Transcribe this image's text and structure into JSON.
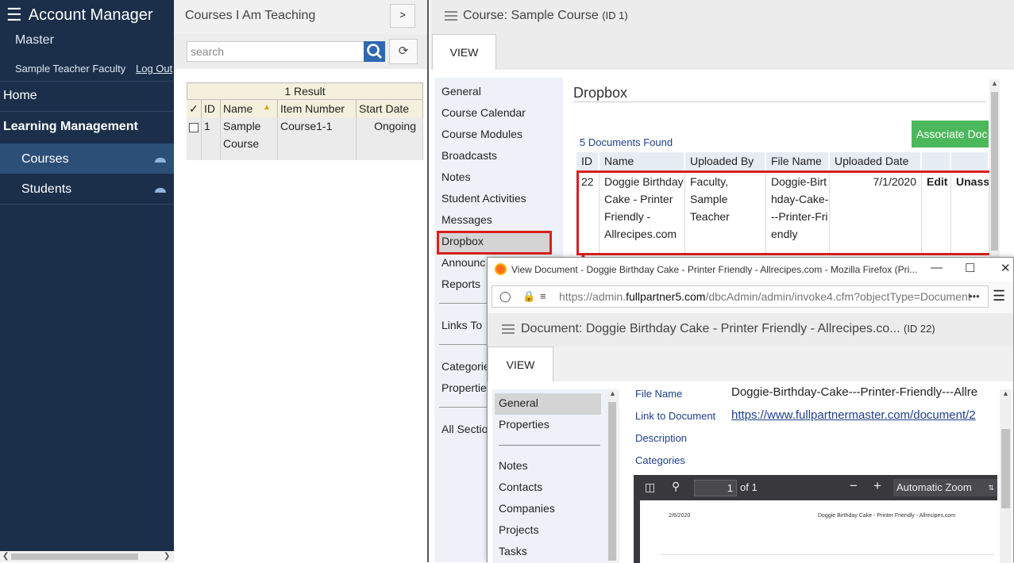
{
  "sidebar": {
    "app_title": "Account Manager",
    "org": "Master",
    "user": "Sample Teacher Faculty",
    "logout": "Log Out",
    "home": "Home",
    "section": "Learning Management",
    "items": [
      {
        "label": "Courses"
      },
      {
        "label": "Students"
      }
    ]
  },
  "course_list": {
    "title": "Courses I Am Teaching",
    "expand_label": ">",
    "search_placeholder": "search",
    "result_count": "1 Result",
    "columns": [
      "✓",
      "ID",
      "Name",
      "Item Number",
      "Start Date"
    ],
    "rows": [
      {
        "id": "1",
        "name": "Sample Course",
        "item_number": "Course1-1",
        "start_date": "Ongoing"
      }
    ]
  },
  "course": {
    "title": "Course: Sample Course",
    "id_label": "(ID 1)",
    "tab": "VIEW",
    "nav": [
      "General",
      "Course Calendar",
      "Course Modules",
      "Broadcasts",
      "Notes",
      "Student Activities",
      "Messages",
      "Dropbox",
      "Announc",
      "Reports",
      "Links To",
      "Categorie",
      "Propertie",
      "All Sectio"
    ],
    "dropbox": {
      "title": "Dropbox",
      "button": "Associate Doc",
      "found": "5 Documents Found",
      "columns": [
        "ID",
        "Name",
        "Uploaded By",
        "File Name",
        "Uploaded Date"
      ],
      "row": {
        "id": "22",
        "name": "Doggie Birthday Cake - Printer Friendly - Allrecipes.com",
        "uploaded_by": "Faculty, Sample Teacher",
        "file_name": "Doggie-Birthday-Cake---Printer-Friendly",
        "uploaded_date": "7/1/2020",
        "edit": "Edit",
        "unassign": "Unass"
      }
    }
  },
  "popup": {
    "window_title": "View Document - Doggie Birthday Cake - Printer Friendly - Allrecipes.com - Mozilla Firefox (Pri...",
    "url_prefix": "https://",
    "url_host_pre": "admin.",
    "url_host": "fullpartner5.com",
    "url_path": "/dbcAdmin/admin/invoke4.cfm?objectType=Document",
    "doc_title": "Document: Doggie Birthday Cake - Printer Friendly - Allrecipes.co...",
    "doc_id": "(ID 22)",
    "tab": "VIEW",
    "nav": [
      "General",
      "Properties",
      "Notes",
      "Contacts",
      "Companies",
      "Projects",
      "Tasks"
    ],
    "fields": [
      {
        "label": "File Name",
        "value": "Doggie-Birthday-Cake---Printer-Friendly---Allre"
      },
      {
        "label": "Link to Document",
        "value": "https://www.fullpartnermaster.com/document/2"
      },
      {
        "label": "Description",
        "value": ""
      },
      {
        "label": "Categories",
        "value": ""
      }
    ],
    "pdf": {
      "page": "1",
      "of": "of 1",
      "zoom": "Automatic Zoom",
      "date": "2/6/2020",
      "header": "Doggie Birthday Cake - Printer Friendly - Allrecipes.com"
    }
  },
  "colors": {
    "sidebar": "#1b2f4a",
    "active_nav": "#2c4f78",
    "highlight": "#d9201c",
    "associate_button": "#4cb85c"
  }
}
